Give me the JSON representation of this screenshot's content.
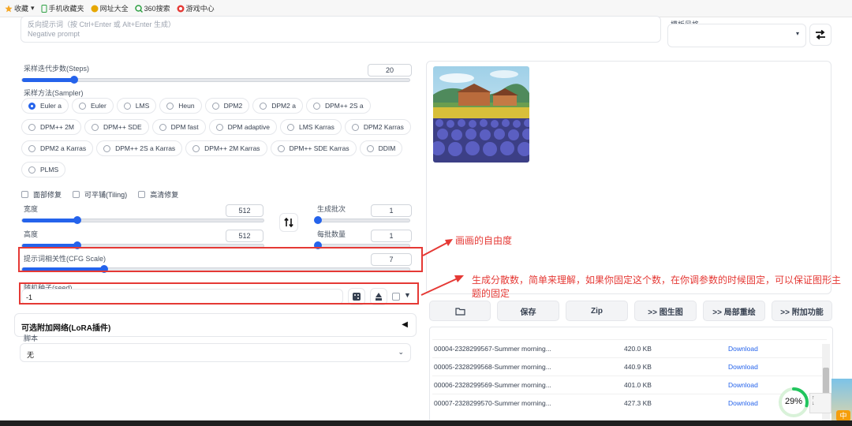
{
  "bookmarks": [
    "收藏",
    "手机收藏夹",
    "网址大全",
    "360搜索",
    "游戏中心"
  ],
  "negative_prompt": {
    "label": "反向提示词（按 Ctrl+Enter 或 Alt+Enter 生成）",
    "placeholder": "Negative prompt"
  },
  "template": {
    "label": "模板风格"
  },
  "steps": {
    "label": "采样迭代步数(Steps)",
    "value": "20",
    "fraction": 0.2
  },
  "sampler": {
    "label": "采样方法(Sampler)",
    "selected": "Euler a",
    "options": [
      "Euler a",
      "Euler",
      "LMS",
      "Heun",
      "DPM2",
      "DPM2 a",
      "DPM++ 2S a",
      "DPM++ 2M",
      "DPM++ SDE",
      "DPM fast",
      "DPM adaptive",
      "LMS Karras",
      "DPM2 Karras",
      "DPM2 a Karras",
      "DPM++ 2S a Karras",
      "DPM++ 2M Karras",
      "DPM++ SDE Karras",
      "DDIM",
      "PLMS"
    ]
  },
  "checkboxes": [
    "面部修复",
    "可平铺(Tiling)",
    "高清修复"
  ],
  "width": {
    "label": "宽度",
    "value": "512",
    "fraction": 0.22
  },
  "height": {
    "label": "高度",
    "value": "512",
    "fraction": 0.22
  },
  "batch_count": {
    "label": "生成批次",
    "value": "1",
    "fraction": 0.0
  },
  "batch_size": {
    "label": "每批数量",
    "value": "1",
    "fraction": 0.0
  },
  "cfg": {
    "label": "提示词相关性(CFG Scale)",
    "value": "7",
    "fraction": 0.2
  },
  "seed": {
    "label": "随机种子(seed)",
    "value": "-1"
  },
  "lora": {
    "label": "可选附加网络(LoRA插件)",
    "toggle": "◀"
  },
  "script": {
    "label": "脚本",
    "value": "无"
  },
  "actions": [
    "保存",
    "Zip",
    ">> 图生图",
    ">> 局部重绘",
    ">> 附加功能"
  ],
  "files": [
    {
      "name": "00004-2328299567-Summer morning...",
      "size": "420.0 KB",
      "link": "Download"
    },
    {
      "name": "00005-2328299568-Summer morning...",
      "size": "440.9 KB",
      "link": "Download"
    },
    {
      "name": "00006-2328299569-Summer morning...",
      "size": "401.0 KB",
      "link": "Download"
    },
    {
      "name": "00007-2328299570-Summer morning...",
      "size": "427.3 KB",
      "link": "Download"
    }
  ],
  "annotations": {
    "cfg_note": "画画的自由度",
    "seed_note": "生成分散数，简单来理解，如果你固定这个数，在你调参数的时候固定，可以保证图形主题的固定"
  },
  "progress": {
    "text": "29%",
    "fraction": 0.29
  },
  "tray": {
    "ime": "中"
  }
}
